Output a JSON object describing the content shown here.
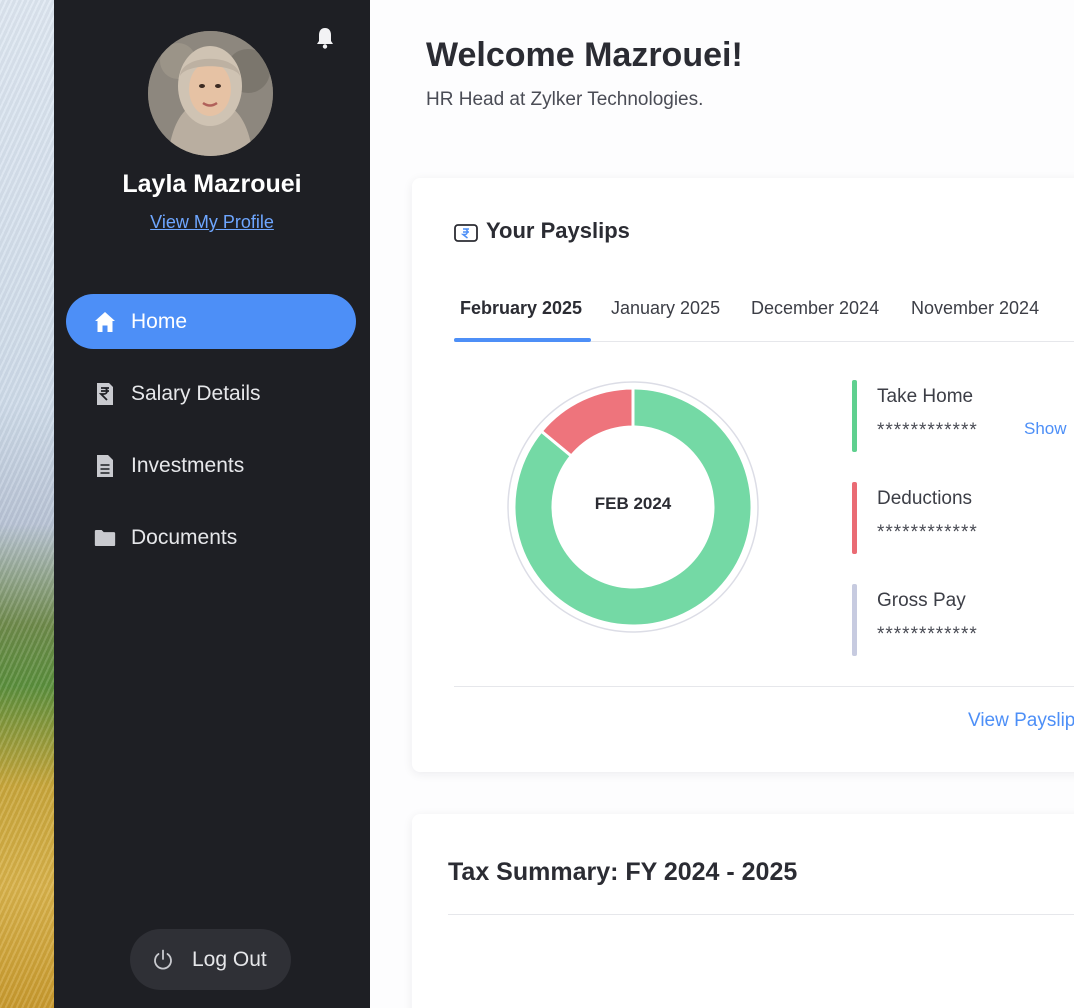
{
  "sidebar": {
    "user_name": "Layla Mazrouei",
    "profile_link": "View My Profile",
    "items": [
      {
        "label": "Home",
        "icon": "home-icon",
        "active": true
      },
      {
        "label": "Salary Details",
        "icon": "rupee-document-icon",
        "active": false
      },
      {
        "label": "Investments",
        "icon": "document-icon",
        "active": false
      },
      {
        "label": "Documents",
        "icon": "folder-icon",
        "active": false
      }
    ],
    "logout_label": "Log Out"
  },
  "header": {
    "welcome": "Welcome Mazrouei!",
    "subtitle": "HR Head at Zylker Technologies."
  },
  "payslips": {
    "title": "Your Payslips",
    "tabs": [
      "February 2025",
      "January 2025",
      "December 2024",
      "November 2024"
    ],
    "active_tab": "February 2025",
    "donut_label": "FEB 2024",
    "legend": [
      {
        "name": "Take Home",
        "masked": "************",
        "action": "Show",
        "color": "#5fd08f"
      },
      {
        "name": "Deductions",
        "masked": "************",
        "color": "#ea6b74"
      },
      {
        "name": "Gross Pay",
        "masked": "************",
        "color": "#c7cbe0"
      }
    ],
    "view_link": "View Payslips"
  },
  "tax": {
    "title": "Tax Summary: FY 2024 - 2025"
  },
  "chart_data": {
    "type": "pie",
    "title": "FEB 2024",
    "slices": [
      {
        "label": "Take Home",
        "value": 86,
        "color": "#74d9a5"
      },
      {
        "label": "Deductions",
        "value": 14,
        "color": "#ee747c"
      }
    ]
  },
  "colors": {
    "accent": "#4d8ff7",
    "sidebar_bg": "#1e1f24",
    "take_home": "#74d9a5",
    "deductions": "#ee747c"
  }
}
